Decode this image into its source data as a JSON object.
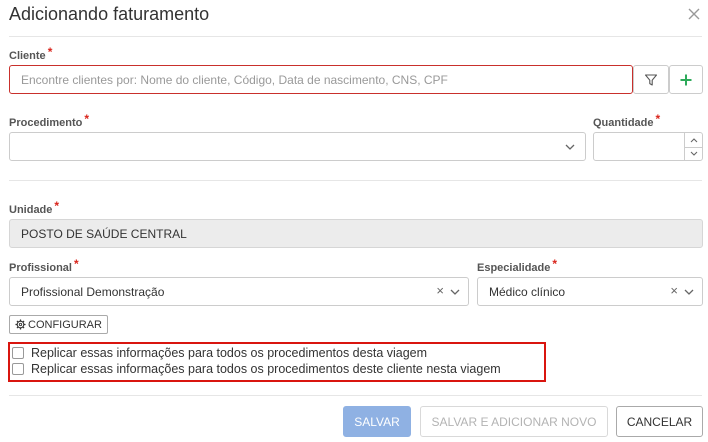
{
  "dialog": {
    "title": "Adicionando faturamento"
  },
  "cliente": {
    "label": "Cliente",
    "required_mark": "*",
    "placeholder": "Encontre clientes por: Nome do cliente, Código, Data de nascimento, CNS, CPF"
  },
  "procedimento": {
    "label": "Procedimento",
    "required_mark": "*",
    "value": ""
  },
  "quantidade": {
    "label": "Quantidade",
    "required_mark": "*",
    "value": ""
  },
  "unidade": {
    "label": "Unidade",
    "required_mark": "*",
    "value": "POSTO DE SAÚDE CENTRAL"
  },
  "profissional": {
    "label": "Profissional",
    "required_mark": "*",
    "value": "Profissional Demonstração"
  },
  "especialidade": {
    "label": "Especialidade",
    "required_mark": "*",
    "value": "Médico clínico"
  },
  "configurar": {
    "label": "CONFIGURAR"
  },
  "options": {
    "replicate_trip": "Replicar essas informações para todos os procedimentos desta viagem",
    "replicate_client": "Replicar essas informações para todos os procedimentos deste cliente nesta viagem"
  },
  "footer": {
    "save": "SALVAR",
    "save_and_add": "SALVAR E ADICIONAR NOVO",
    "cancel": "CANCELAR"
  },
  "colors": {
    "required": "#d9251c",
    "error_border": "#c9302c",
    "highlight_border": "#d9150f",
    "primary_disabled": "#8fb1e3",
    "add_icon": "#2eaa5a"
  }
}
